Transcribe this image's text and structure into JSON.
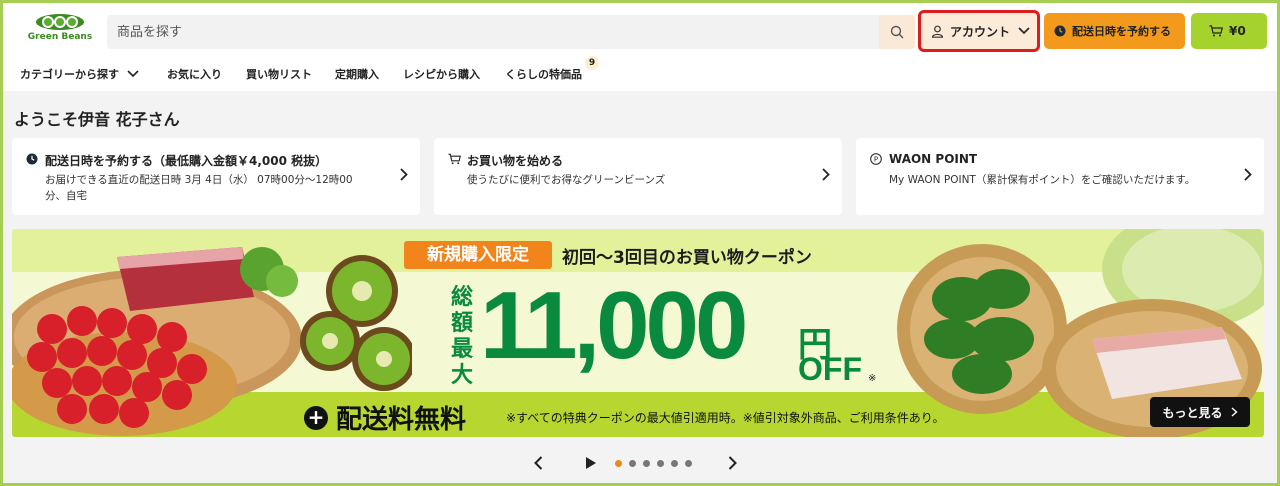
{
  "colors": {
    "brand_green": "#3b8a24",
    "frame_green": "#a6cf52",
    "account_highlight": "#e01b1b",
    "orange": "#f39a1c",
    "lime": "#a6d22e",
    "banner_green_text": "#0a8a3e"
  },
  "header": {
    "logo_text": "Green Beans",
    "search": {
      "placeholder": "商品を探す",
      "icon": "search-icon"
    },
    "account_label": "アカウント",
    "delivery_label": "配送日時を予約する",
    "cart_label": "¥0"
  },
  "nav": {
    "items": [
      {
        "label": "カテゴリーから探す"
      },
      {
        "label": "お気に入り"
      },
      {
        "label": "買い物リスト"
      },
      {
        "label": "定期購入"
      },
      {
        "label": "レシピから購入"
      },
      {
        "label": "くらしの特価品"
      }
    ],
    "badge_count": "9"
  },
  "welcome": "ようこそ伊音 花子さん",
  "cards": [
    {
      "title": "配送日時を予約する（最低購入金額￥4,000 税抜）",
      "desc_line1": "お届けできる直近の配送日時 3月 4日（水） 07時00分～12時00",
      "desc_line2": "分、自宅"
    },
    {
      "title": "お買い物を始める",
      "desc_line1": "使うたびに便利でお得なグリーンビーンズ"
    },
    {
      "title": "WAON POINT",
      "desc_line1": "My WAON POINT（累計保有ポイント）をご確認いただけます。"
    }
  ],
  "banner": {
    "badge": "新規購入限定",
    "headline": "初回～3回目のお買い物クーポン",
    "label_1": "総額",
    "label_2": "最大",
    "amount": "11,000",
    "yen": "円",
    "off": "OFF",
    "asterisk": "※",
    "free_shipping": "配送料無料",
    "note": "※すべての特典クーポンの最大値引適用時。※値引対象外商品、ご利用条件あり。",
    "more_label": "もっと見る"
  },
  "carousel": {
    "dots": 6,
    "active": 0
  }
}
